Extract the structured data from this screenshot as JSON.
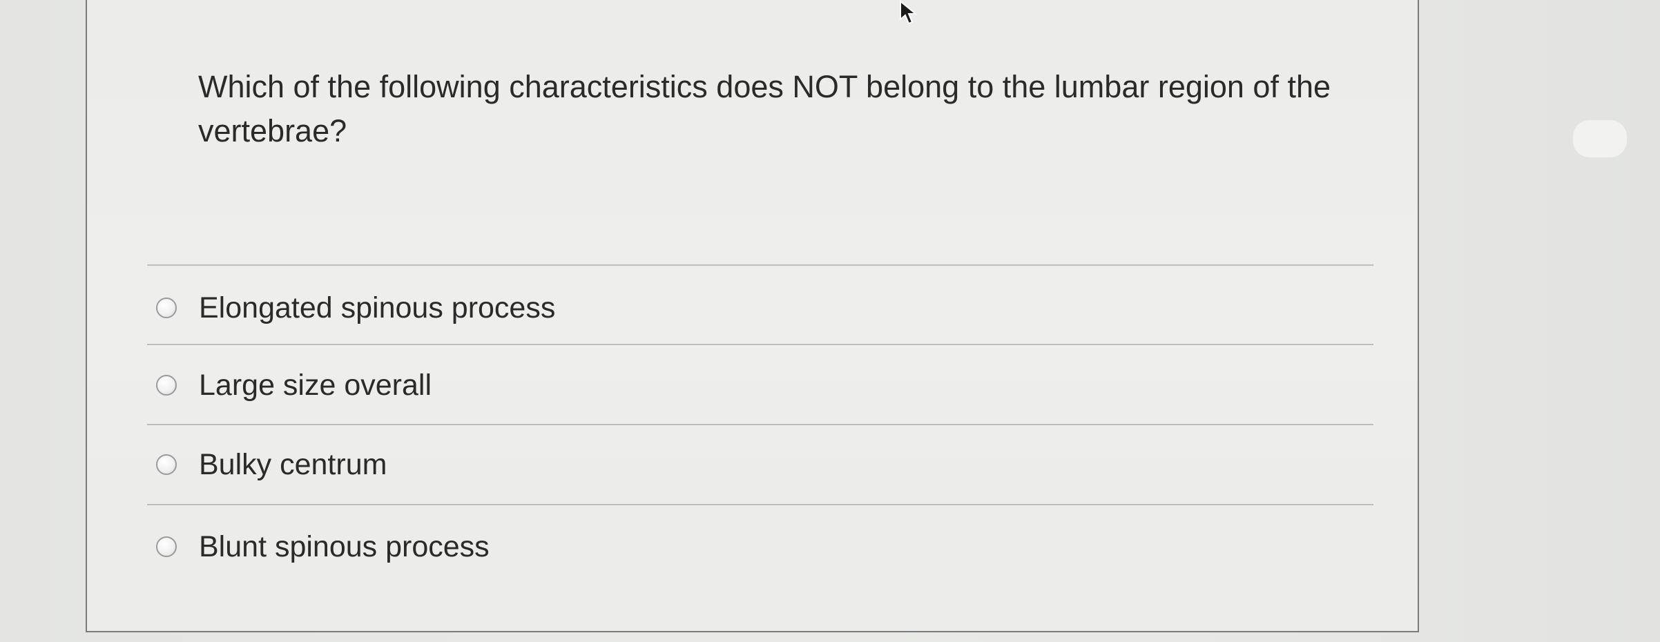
{
  "question": {
    "text": "Which of the following characteristics does NOT belong to the lumbar region of the vertebrae?"
  },
  "choices": [
    {
      "label": "Elongated spinous process",
      "selected": false
    },
    {
      "label": "Large size overall",
      "selected": false
    },
    {
      "label": "Bulky centrum",
      "selected": false
    },
    {
      "label": "Blunt spinous process",
      "selected": false
    }
  ],
  "icons": {
    "cursor": "mouse-pointer-icon",
    "radio": "radio-button-icon"
  },
  "colors": {
    "background": "#e8e9e6",
    "card_border": "#7a7a7a",
    "text": "#2a2a2a",
    "divider": "#bdbdbb"
  }
}
